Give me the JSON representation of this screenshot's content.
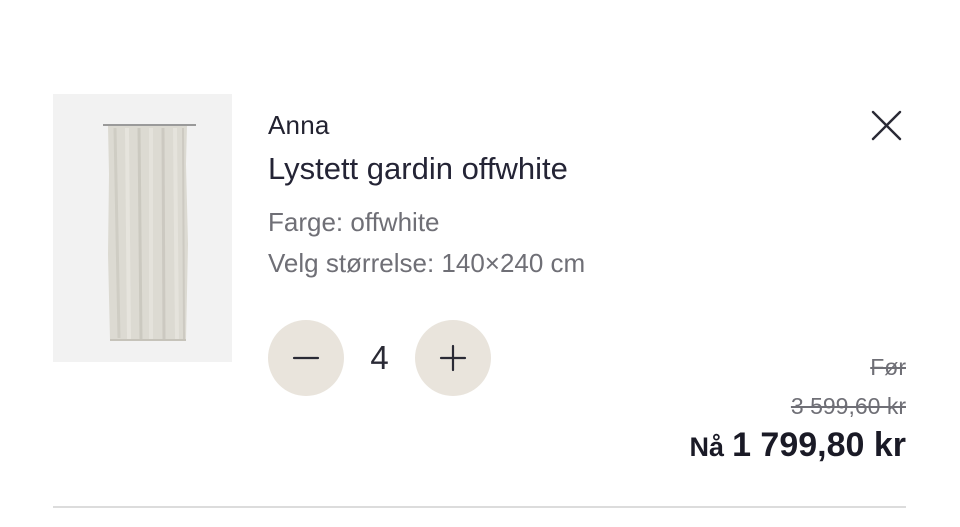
{
  "item": {
    "brand": "Anna",
    "title": "Lystett gardin offwhite",
    "color_attr": "Farge: offwhite",
    "size_attr": "Velg størrelse: 140×240 cm",
    "quantity": "4",
    "image_alt": "Lystett gardin offwhite product image"
  },
  "price": {
    "before_label": "Før",
    "before_value": "3 599,60 kr",
    "now_label": "Nå",
    "now_value": "1 799,80 kr"
  },
  "icons": {
    "close": "close-icon",
    "minus": "minus-icon",
    "plus": "plus-icon"
  },
  "colors": {
    "qty_button_bg": "#e9e4dc",
    "text_primary": "#242435",
    "text_muted": "#6f6f76",
    "divider": "#dcdcdc"
  }
}
